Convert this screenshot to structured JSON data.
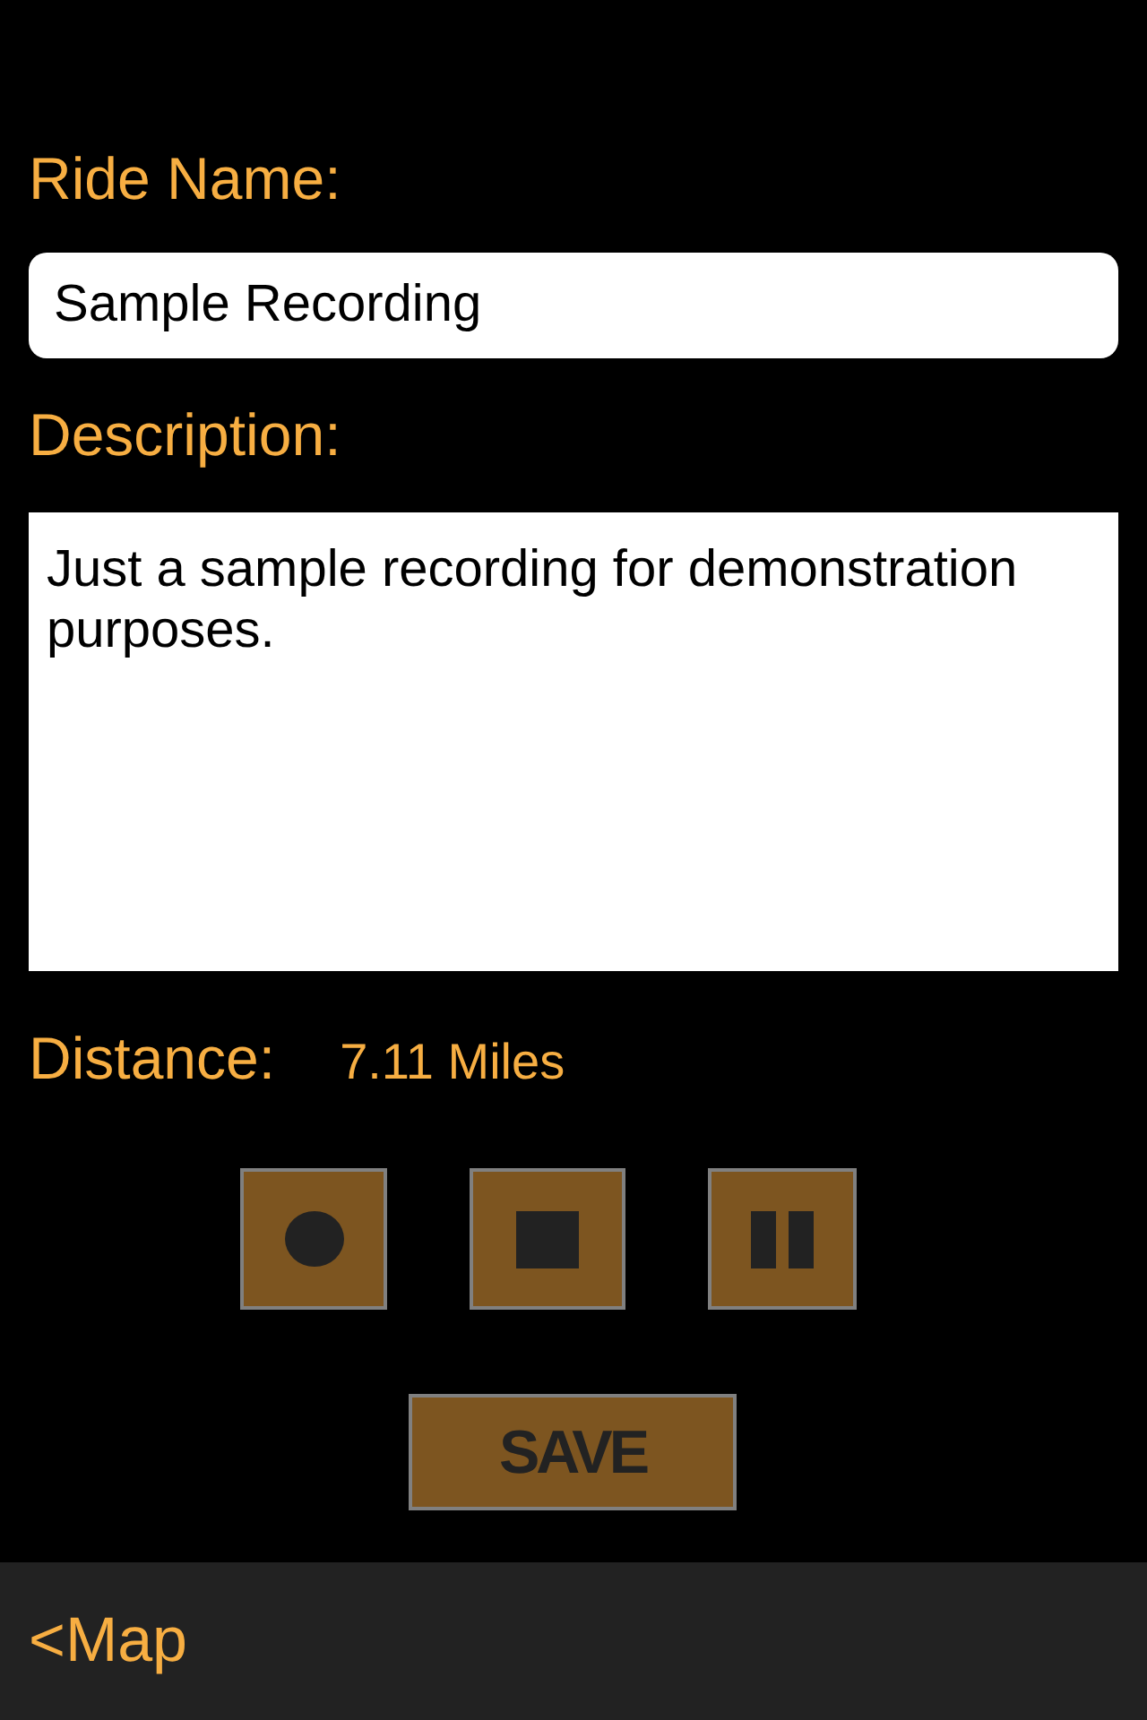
{
  "form": {
    "ride_name": {
      "label": "Ride Name:",
      "value": "Sample Recording"
    },
    "description": {
      "label": "Description:",
      "value": "Just a sample recording for demonstration purposes."
    },
    "distance": {
      "label": "Distance:",
      "value": "7.11 Miles"
    }
  },
  "controls": [
    {
      "kind": "record"
    },
    {
      "kind": "stop"
    },
    {
      "kind": "pause"
    }
  ],
  "save_button": {
    "label": "SAVE"
  },
  "bottom_bar": {
    "back_link": "<Map"
  }
}
